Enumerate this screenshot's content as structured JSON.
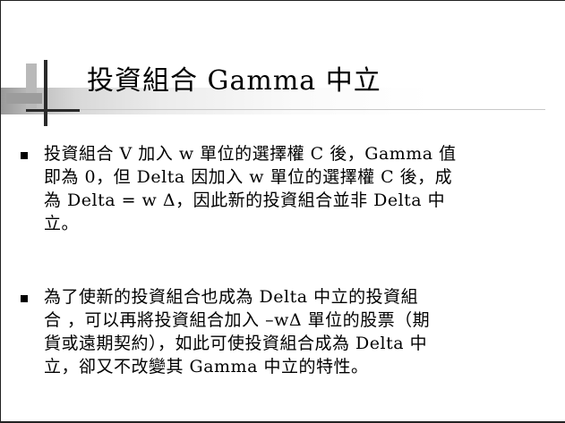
{
  "title": "投資組合 Gamma 中立",
  "bullets": [
    {
      "lines": [
        "投資組合 V 加入 w 單位的選擇權 C 後，Gamma 值",
        "即為 0，但 Delta 因加入 w 單位的選擇權 C 後，成",
        "為 Delta = w Δ，因此新的投資組合並非 Delta  中",
        "立。"
      ]
    },
    {
      "lines": [
        "為了使新的投資組合也成為 Delta 中立的投資組",
        "合 ，可以再將投資組合加入 –wΔ 單位的股票（期",
        "貨或遠期契約），如此可使投資組合成為 Delta 中",
        "立，卻又不改變其 Gamma 中立的特性。"
      ]
    }
  ]
}
